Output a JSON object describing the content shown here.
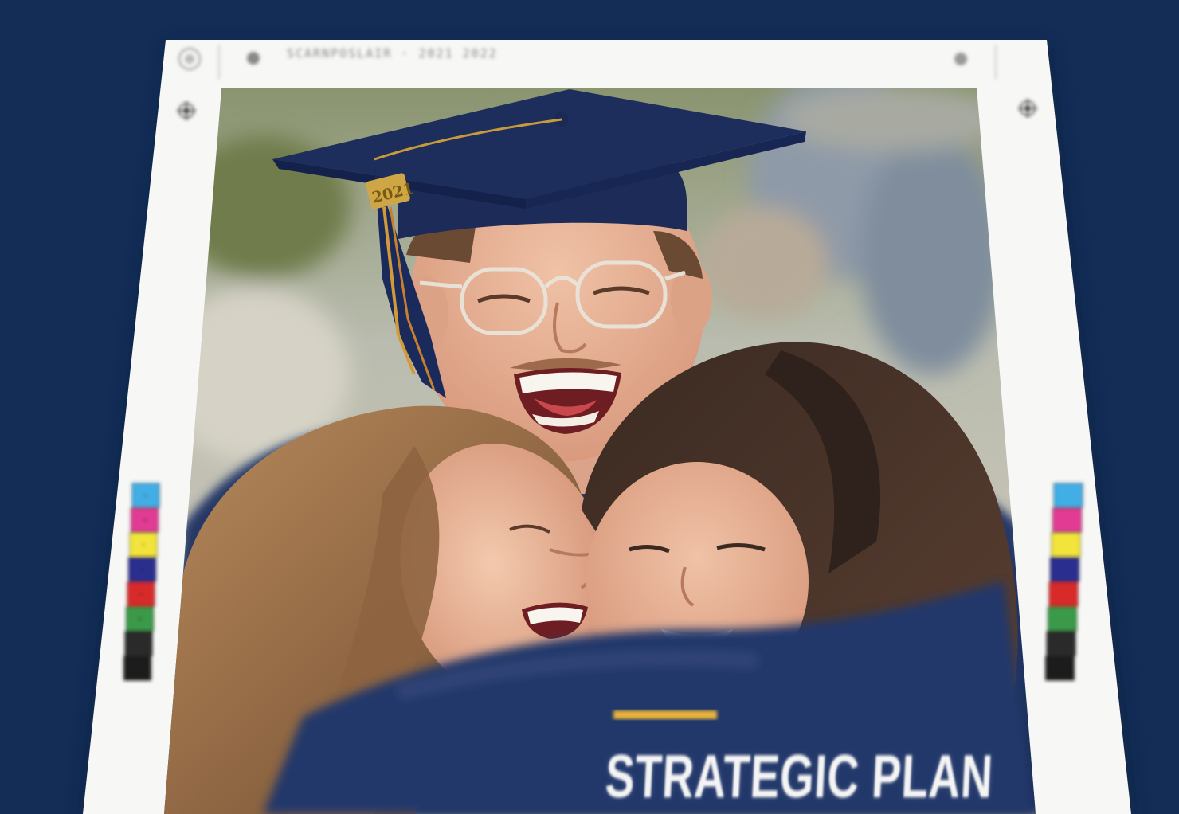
{
  "header": {
    "slug_text": "SCARNPOSLAIR  ·  2021  2022"
  },
  "cover": {
    "title": "STRATEGIC PLAN",
    "cap_charm_year": "2021",
    "accent_color": "#f0b03c",
    "navy_color": "#1b2f5c"
  },
  "color_bar": {
    "swatches": [
      {
        "color": "#42aee6",
        "letter": "C"
      },
      {
        "color": "#e23a93",
        "letter": "M"
      },
      {
        "color": "#f3e43a",
        "letter": "Y"
      },
      {
        "color": "#2a2f8e",
        "letter": "K"
      },
      {
        "color": "#d92b2b",
        "letter": "R"
      },
      {
        "color": "#3a9a4a",
        "letter": "G"
      },
      {
        "color": "#2b2b2b",
        "letter": ""
      },
      {
        "color": "#1a1a1a",
        "letter": ""
      }
    ]
  },
  "background_color": "#132d57"
}
